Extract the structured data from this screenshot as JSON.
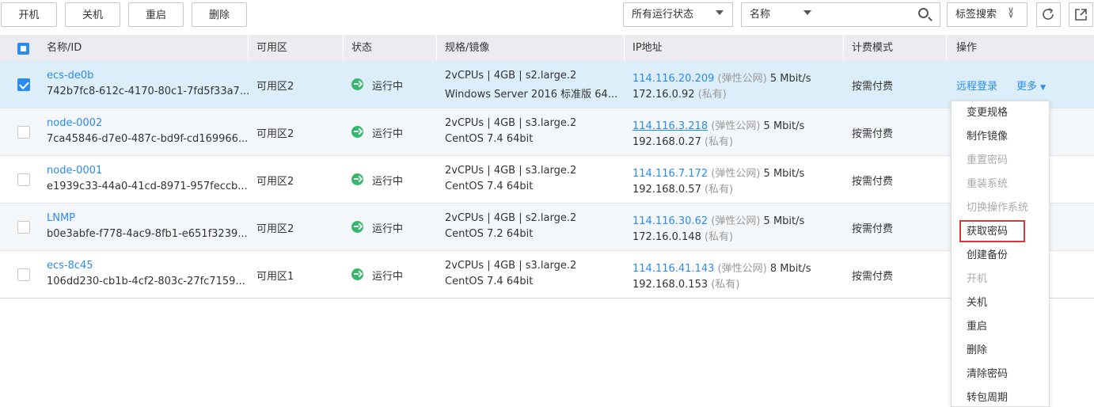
{
  "toolbar": {
    "start": "开机",
    "stop": "关机",
    "restart": "重启",
    "delete": "删除",
    "status_filter": "所有运行状态",
    "search_field": "名称",
    "search_value": "",
    "tag_search": "标签搜索"
  },
  "columns": [
    "名称/ID",
    "可用区",
    "状态",
    "规格/镜像",
    "IP地址",
    "计费模式",
    "操作"
  ],
  "rows": [
    {
      "checked": true,
      "name": "ecs-de0b",
      "id": "742b7fc8-612c-4170-80c1-7fd5f33a7...",
      "zone": "可用区2",
      "status": "运行中",
      "spec": "2vCPUs | 4GB | s2.large.2",
      "image": "Windows Server 2016 标准版 64...",
      "eip": "114.116.20.209",
      "eip_tag": "(弹性公网)",
      "bandwidth": "5 Mbit/s",
      "private_ip": "172.16.0.92",
      "private_tag": "(私有)",
      "billing": "按需付费",
      "remote_login": "远程登录",
      "more": "更多"
    },
    {
      "checked": false,
      "name": "node-0002",
      "id": "7ca45846-d7e0-487c-bd9f-cd169966...",
      "zone": "可用区2",
      "status": "运行中",
      "spec": "2vCPUs | 4GB | s3.large.2",
      "image": "CentOS 7.4 64bit",
      "eip": "114.116.3.218",
      "eip_tag": "(弹性公网)",
      "bandwidth": "5 Mbit/s",
      "private_ip": "192.168.0.27",
      "private_tag": "(私有)",
      "billing": "按需付费"
    },
    {
      "checked": false,
      "name": "node-0001",
      "id": "e1939c33-44a0-41cd-8971-957feccb...",
      "zone": "可用区2",
      "status": "运行中",
      "spec": "2vCPUs | 4GB | s3.large.2",
      "image": "CentOS 7.4 64bit",
      "eip": "114.116.7.172",
      "eip_tag": "(弹性公网)",
      "bandwidth": "5 Mbit/s",
      "private_ip": "192.168.0.57",
      "private_tag": "(私有)",
      "billing": "按需付费"
    },
    {
      "checked": false,
      "name": "LNMP",
      "id": "b0e3abfe-f778-4ac9-8fb1-e651f3239...",
      "zone": "可用区2",
      "status": "运行中",
      "spec": "2vCPUs | 4GB | s2.large.2",
      "image": "CentOS 7.2 64bit",
      "eip": "114.116.30.62",
      "eip_tag": "(弹性公网)",
      "bandwidth": "5 Mbit/s",
      "private_ip": "172.16.0.148",
      "private_tag": "(私有)",
      "billing": "按需付费"
    },
    {
      "checked": false,
      "name": "ecs-8c45",
      "id": "106dd230-cb1b-4cf2-803c-27fc7159...",
      "zone": "可用区1",
      "status": "运行中",
      "spec": "2vCPUs | 4GB | s3.large.2",
      "image": "CentOS 7.4 64bit",
      "eip": "114.116.41.143",
      "eip_tag": "(弹性公网)",
      "bandwidth": "8 Mbit/s",
      "private_ip": "192.168.0.153",
      "private_tag": "(私有)",
      "billing": "按需付费"
    }
  ],
  "more_menu": [
    {
      "label": "变更规格",
      "disabled": false
    },
    {
      "label": "制作镜像",
      "disabled": false
    },
    {
      "label": "重置密码",
      "disabled": true
    },
    {
      "label": "重装系统",
      "disabled": true
    },
    {
      "label": "切换操作系统",
      "disabled": true
    },
    {
      "label": "获取密码",
      "disabled": false,
      "highlighted": true
    },
    {
      "label": "创建备份",
      "disabled": false
    },
    {
      "label": "开机",
      "disabled": true
    },
    {
      "label": "关机",
      "disabled": false
    },
    {
      "label": "重启",
      "disabled": false
    },
    {
      "label": "删除",
      "disabled": false
    },
    {
      "label": "清除密码",
      "disabled": false
    },
    {
      "label": "转包周期",
      "disabled": false
    }
  ],
  "colors": {
    "accent": "#2a8bf2",
    "running": "#35b86b",
    "selected_row": "#dceefa",
    "alt_row": "#f4f7fa",
    "highlight_box": "#d9343b"
  }
}
